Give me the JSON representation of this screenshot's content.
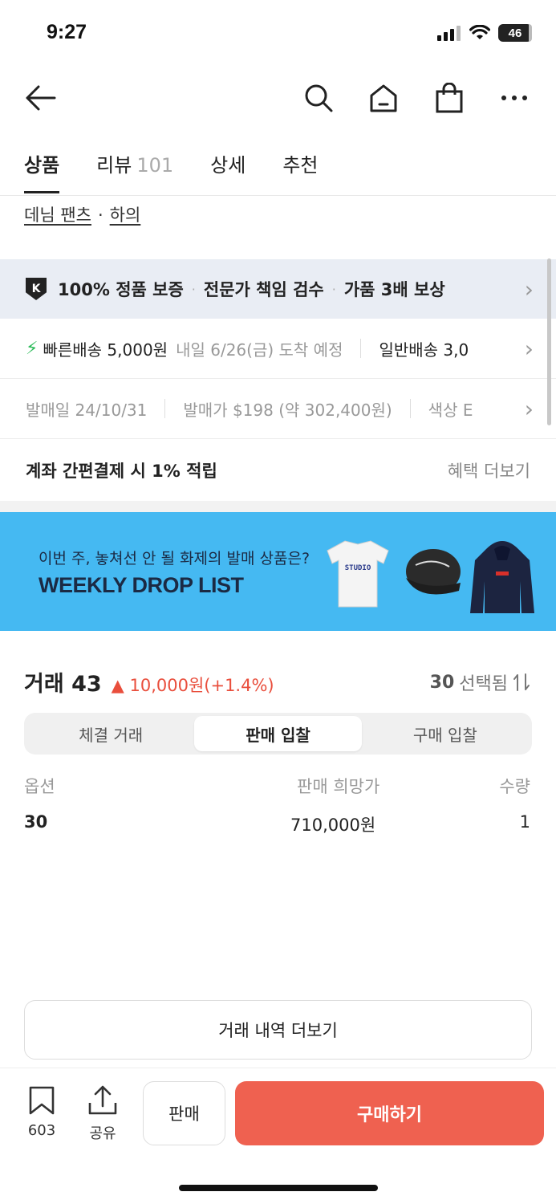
{
  "status": {
    "time": "9:27",
    "battery": "46"
  },
  "tabs": [
    {
      "label": "상품"
    },
    {
      "label": "리뷰",
      "count": "101"
    },
    {
      "label": "상세"
    },
    {
      "label": "추천"
    }
  ],
  "breadcrumb": {
    "first": "데님 팬츠",
    "separator": "·",
    "second": "하의"
  },
  "guarantee": {
    "badge": "K",
    "item1": "100% 정품 보증",
    "item2": "전문가 책임 검수",
    "item3": "가품 3배 보상",
    "sep": "·"
  },
  "shipping": {
    "fast_label": "빠른배송 5,000원",
    "fast_eta": "내일 6/26(금) 도착 예정",
    "normal_label": "일반배송 3,0"
  },
  "info": {
    "release": "발매일 24/10/31",
    "price": "발매가 $198 (약 302,400원)",
    "color": "색상 E"
  },
  "benefit": {
    "title": "계좌 간편결제 시 1% 적립",
    "more": "혜택 더보기"
  },
  "banner": {
    "subtitle": "이번 주, 놓쳐선 안 될 화제의 발매 상품은?",
    "title": "WEEKLY DROP LIST",
    "tshirt_text": "STUDIO"
  },
  "trade": {
    "title": "거래 43",
    "change": "▲ 10,000원(+1.4%)",
    "selected_size": "30",
    "selected_label": "선택됨",
    "segments": [
      "체결 거래",
      "판매 입찰",
      "구매 입찰"
    ],
    "columns": [
      "옵션",
      "판매 희망가",
      "수량"
    ],
    "rows": [
      {
        "option": "30",
        "price": "710,000원",
        "qty": "1"
      }
    ],
    "more_label": "거래 내역 더보기"
  },
  "bottom": {
    "bookmark_count": "603",
    "share_label": "공유",
    "sell_label": "판매",
    "buy_label": "구매하기"
  }
}
